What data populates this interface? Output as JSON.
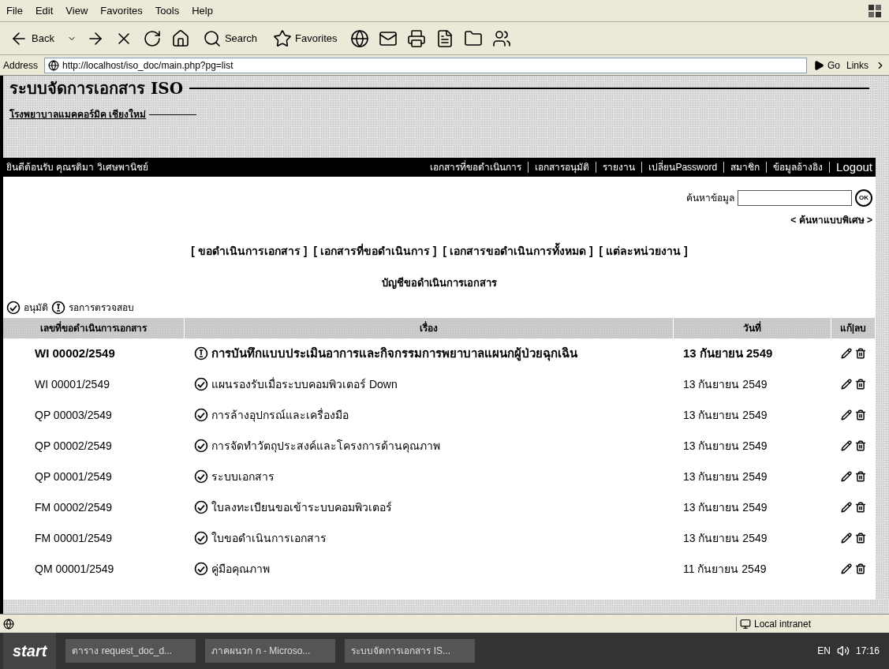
{
  "menu": [
    "File",
    "Edit",
    "View",
    "Favorites",
    "Tools",
    "Help"
  ],
  "toolbar": {
    "back": "Back",
    "search": "Search",
    "favorites": "Favorites"
  },
  "address": {
    "label": "Address",
    "url": "http://localhost/iso_doc/main.php?pg=list",
    "go": "Go",
    "links": "Links"
  },
  "page": {
    "title": "ระบบจัดการเอกสาร ISO",
    "subtitle": "โรงพยาบาลแมคคอร์มิค เชียงใหม่",
    "welcome": "ยินดีต้อนรับ คุณรติมา วิเศษพานิชย์",
    "nav": [
      "เอกสารที่ขอดำเนินการ",
      "เอกสารอนุมัติ",
      "รายงาน",
      "เปลี่ยนPassword",
      "สมาชิก",
      "ข้อมูลอ้างอิง",
      "Logout"
    ],
    "search": {
      "label": "ค้นหาข้อมูล",
      "button": "OK",
      "advanced": "< ค้นหาแบบพิเศษ >"
    },
    "tabs": [
      "[ ขอดำเนินการเอกสาร ]",
      "[ เอกสารที่ขอดำเนินการ ]",
      "[ เอกสารขอดำเนินการทั้งหมด ]",
      "[ แต่ละหน่วยงาน ]"
    ],
    "heading": "บัญชีขอดำเนินการเอกสาร",
    "legend": [
      {
        "kind": "approved",
        "label": "อนุมัติ"
      },
      {
        "kind": "pending",
        "label": "รอการตรวจสอบ"
      }
    ],
    "table": {
      "columns": [
        "เลขที่ขอดำเนินการเอกสาร",
        "เรื่อง",
        "วันที่",
        "แก้|ลบ"
      ],
      "rows": [
        {
          "number": "WI 00002/2549",
          "kind": "pending",
          "bold": true,
          "title": "การบันทึกแบบประเมินอาการและกิจกรรมการพยาบาลแผนกผู้ป่วยฉุกเฉิน",
          "date": "13 กันยายน 2549"
        },
        {
          "number": "WI 00001/2549",
          "kind": "approved",
          "bold": false,
          "title": "แผนรองรับเมื่อระบบคอมพิวเตอร์ Down",
          "date": "13 กันยายน 2549"
        },
        {
          "number": "QP 00003/2549",
          "kind": "approved",
          "bold": false,
          "title": "การล้างอุปกรณ์และเครื่องมือ",
          "date": "13 กันยายน 2549"
        },
        {
          "number": "QP 00002/2549",
          "kind": "approved",
          "bold": false,
          "title": "การจัดทำวัตถุประสงค์และโครงการด้านคุณภาพ",
          "date": "13 กันยายน 2549"
        },
        {
          "number": "QP 00001/2549",
          "kind": "approved",
          "bold": false,
          "title": "ระบบเอกสาร",
          "date": "13 กันยายน 2549"
        },
        {
          "number": "FM 00002/2549",
          "kind": "approved",
          "bold": false,
          "title": "ใบลงทะเบียนขอเข้าระบบคอมพิวเตอร์",
          "date": "13 กันยายน 2549"
        },
        {
          "number": "FM 00001/2549",
          "kind": "approved",
          "bold": false,
          "title": "ใบขอดำเนินการเอกสาร",
          "date": "13 กันยายน 2549"
        },
        {
          "number": "QM 00001/2549",
          "kind": "approved",
          "bold": false,
          "title": "คู่มือคุณภาพ",
          "date": "11 กันยายน 2549"
        }
      ]
    }
  },
  "status_bar": {
    "zone": "Local intranet"
  },
  "taskbar": {
    "start": "start",
    "tasks": [
      "ตาราง request_doc_d...",
      "ภาคผนวก ก - Microso...",
      "ระบบจัดการเอกสาร IS..."
    ],
    "language": "EN",
    "clock": "17:16"
  }
}
